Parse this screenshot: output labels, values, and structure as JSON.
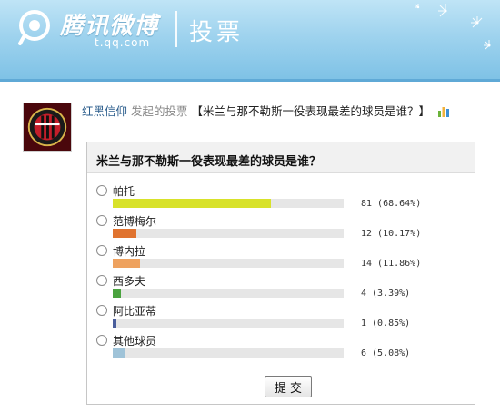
{
  "header": {
    "brand": "腾讯微博",
    "domain": "t.qq.com",
    "section_title": "投票",
    "colors": {
      "header_top": "#bfe4f6",
      "header_bottom": "#7fc2e6"
    }
  },
  "poll_meta": {
    "user": "红黑信仰",
    "action": "发起的投票",
    "title": "【米兰与那不勒斯一役表现最差的球员是谁？】",
    "avatar_icon": "ac-milan-crest-icon",
    "stats_icon": "bar-chart-icon"
  },
  "poll": {
    "question": "米兰与那不勒斯一役表现最差的球员是谁？",
    "options": [
      {
        "label": "帕托",
        "result": "81 (68.64%)",
        "percent": 68.64,
        "color": "#d8e22a"
      },
      {
        "label": "范博梅尔",
        "result": "12 (10.17%)",
        "percent": 10.17,
        "color": "#e0732f"
      },
      {
        "label": "博内拉",
        "result": "14 (11.86%)",
        "percent": 11.86,
        "color": "#eea25f"
      },
      {
        "label": "西多夫",
        "result": "4 (3.39%)",
        "percent": 3.39,
        "color": "#4aa33f"
      },
      {
        "label": "阿比亚蒂",
        "result": "1 (0.85%)",
        "percent": 0.85,
        "color": "#4a5e9c"
      },
      {
        "label": "其他球员",
        "result": "6 (5.08%)",
        "percent": 5.08,
        "color": "#9fc3d8"
      }
    ],
    "submit_label": "提 交"
  }
}
